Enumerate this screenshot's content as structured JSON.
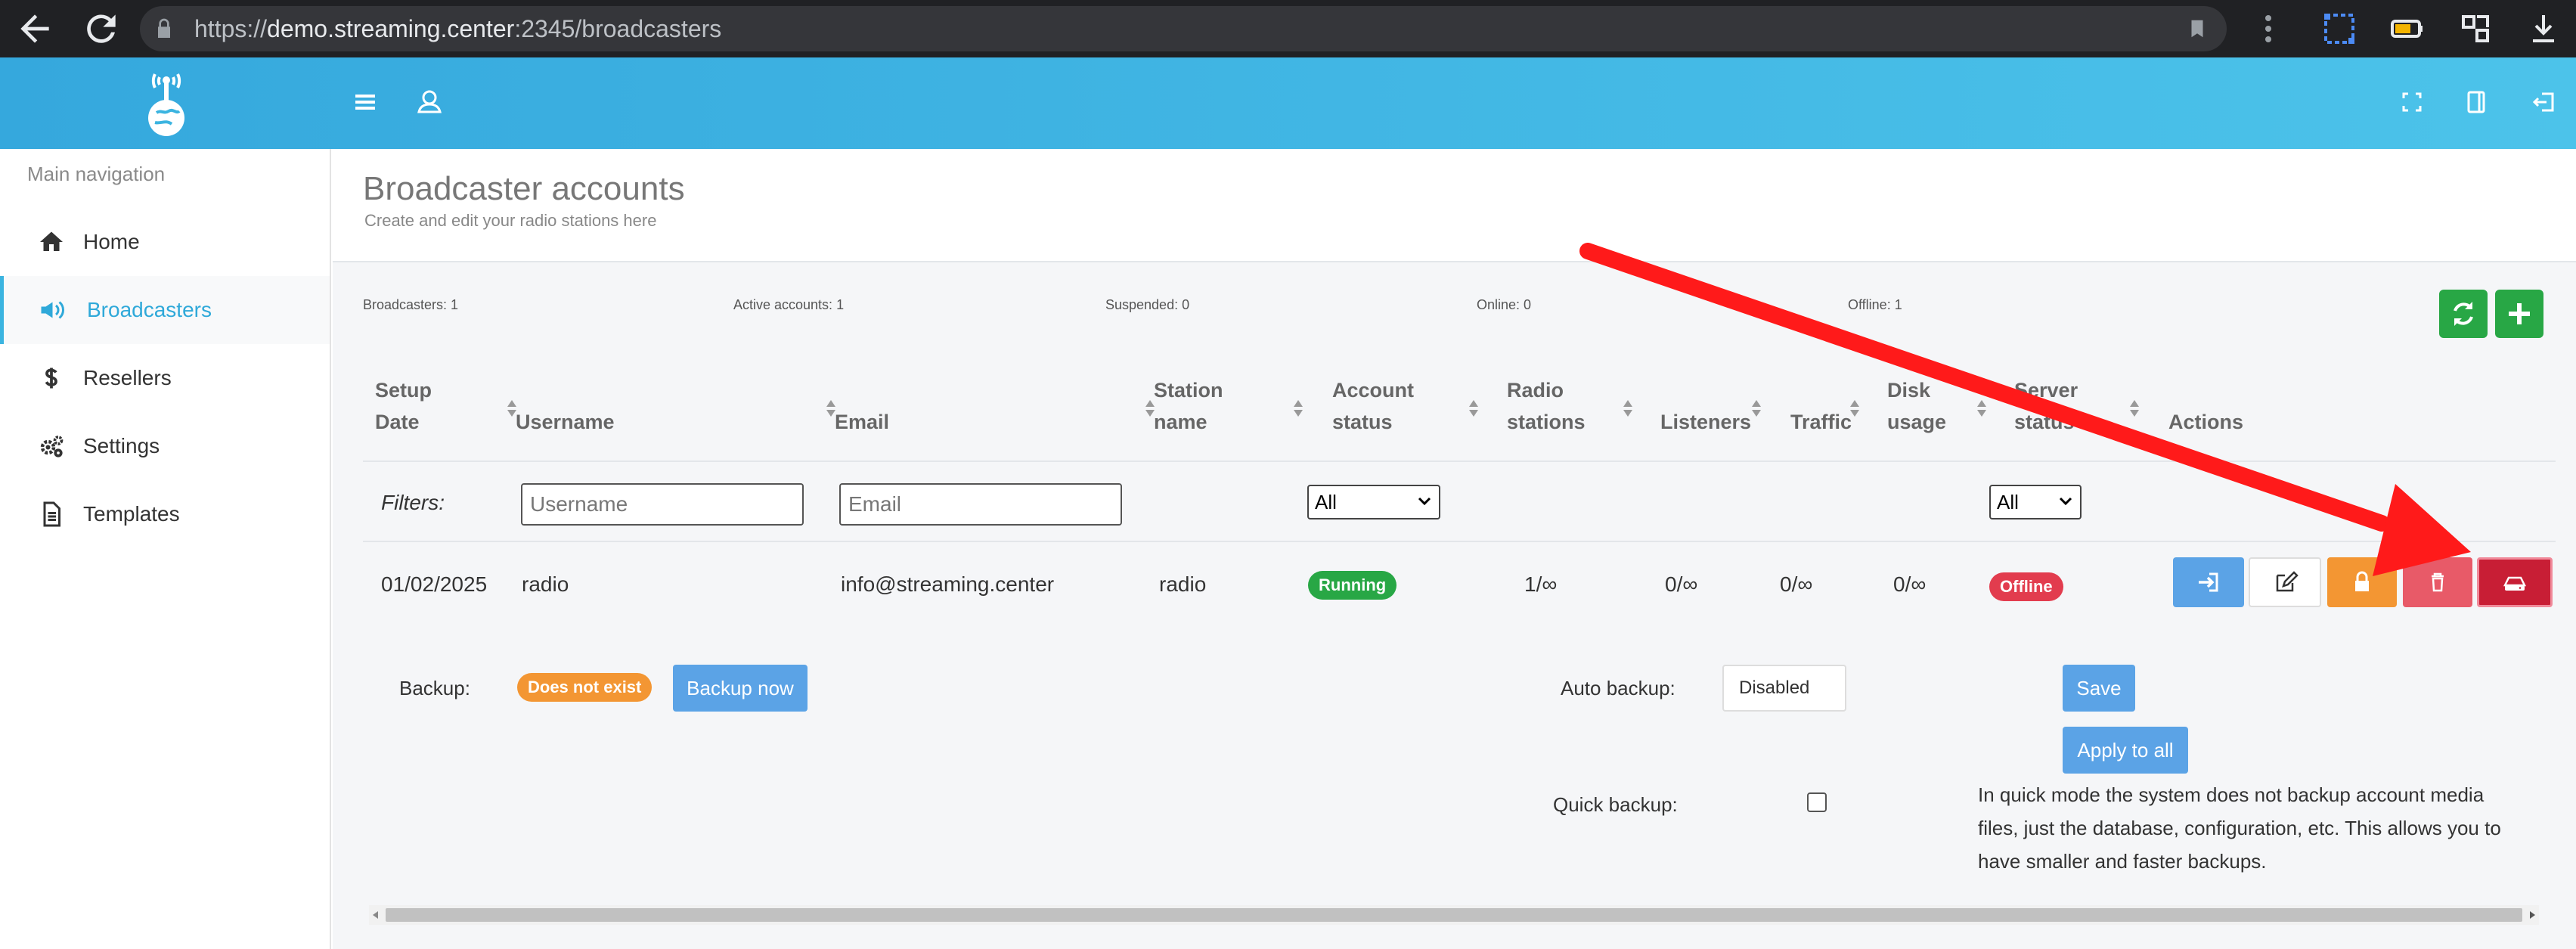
{
  "browser": {
    "url_scheme": "https://",
    "url_host": "demo.streaming.center",
    "url_path": ":2345/broadcasters"
  },
  "sidebar": {
    "caption": "Main navigation",
    "items": [
      {
        "label": "Home",
        "icon": "home-icon"
      },
      {
        "label": "Broadcasters",
        "icon": "megaphone-icon"
      },
      {
        "label": "Resellers",
        "icon": "dollar-icon"
      },
      {
        "label": "Settings",
        "icon": "gears-icon"
      },
      {
        "label": "Templates",
        "icon": "document-icon"
      }
    ]
  },
  "page": {
    "title": "Broadcaster accounts",
    "subtitle": "Create and edit your radio stations here"
  },
  "stats": {
    "broadcasters": "Broadcasters: 1",
    "active": "Active accounts: 1",
    "suspended": "Suspended: 0",
    "online": "Online: 0",
    "offline": "Offline: 1"
  },
  "table": {
    "headers": {
      "setup_date": "Setup Date",
      "username": "Username",
      "email": "Email",
      "station_name": "Station name",
      "account_status": "Account status",
      "radio_stations": "Radio stations",
      "listeners": "Listeners",
      "traffic": "Traffic",
      "disk_usage": "Disk usage",
      "server_status": "Server status",
      "actions": "Actions"
    },
    "filters": {
      "label": "Filters:",
      "username_placeholder": "Username",
      "email_placeholder": "Email",
      "account_status_value": "All",
      "server_status_value": "All"
    },
    "rows": [
      {
        "setup_date": "01/02/2025",
        "username": "radio",
        "email": "info@streaming.center",
        "station_name": "radio",
        "account_status": "Running",
        "radio_stations": "1/∞",
        "listeners": "0/∞",
        "traffic": "0/∞",
        "disk_usage": "0/∞",
        "server_status": "Offline"
      }
    ]
  },
  "backup": {
    "label": "Backup:",
    "status": "Does not exist",
    "backup_now": "Backup now",
    "auto_label": "Auto backup:",
    "auto_value": "Disabled",
    "save": "Save",
    "apply_all": "Apply to all",
    "quick_label": "Quick backup:",
    "quick_checked": false,
    "quick_note": "In quick mode the system does not backup account media files, just the database, configuration, etc. This allows you to have smaller and faster backups."
  },
  "colors": {
    "header_gradient_start": "#35a8dd",
    "header_gradient_end": "#4cc3ea",
    "accent": "#2fa9d9",
    "success": "#28a745",
    "running_badge": "#28a745",
    "offline_badge": "#e23c4e",
    "warning_badge": "#f39633",
    "primary_button": "#5ba3e6",
    "annotation_arrow": "#ff1a1a"
  }
}
